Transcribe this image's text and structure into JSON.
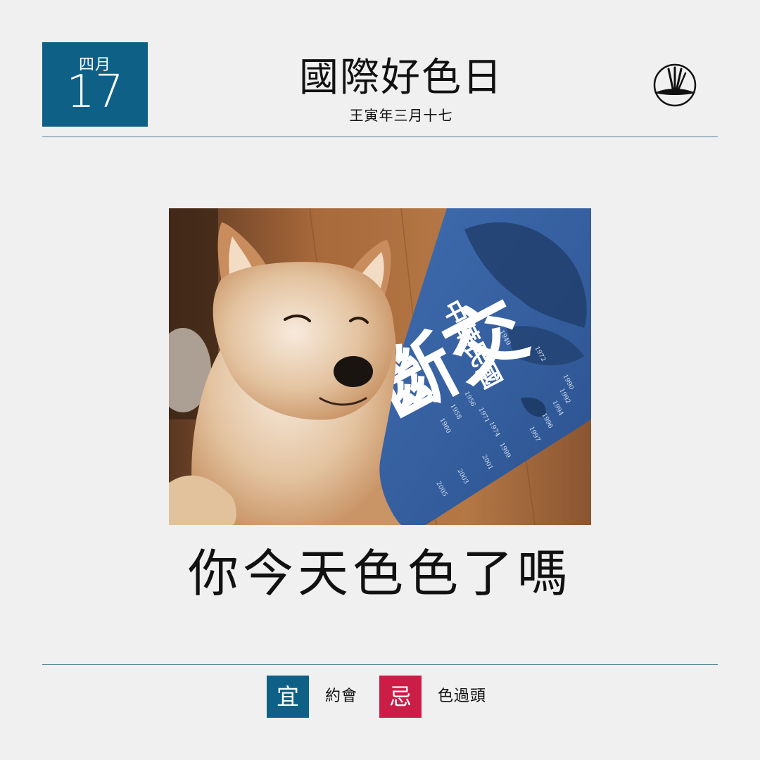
{
  "header": {
    "date": {
      "month": "四月",
      "day": "17"
    },
    "title": "國際好色日",
    "lunar_date": "王寅年三月十七",
    "logo_icon": "brush-circle-logo-icon"
  },
  "photo": {
    "description_icon": "shiba-dog-photo",
    "book_title": "中華民國",
    "book_big_text": "斷交",
    "book_years": [
      "1949",
      "1972",
      "1990",
      "1992",
      "1994",
      "1996",
      "1997",
      "1999",
      "2001",
      "2003",
      "2005",
      "1971",
      "1974",
      "1956",
      "1958",
      "1960"
    ]
  },
  "caption": "你今天色色了嗎",
  "footer": {
    "yi_label": "宜",
    "yi_text": "約會",
    "ji_label": "忌",
    "ji_text": "色過頭"
  },
  "colors": {
    "accent_blue": "#0f6087",
    "accent_red": "#cc1d46",
    "background": "#f0f0f0",
    "rule": "#4d7f97"
  }
}
